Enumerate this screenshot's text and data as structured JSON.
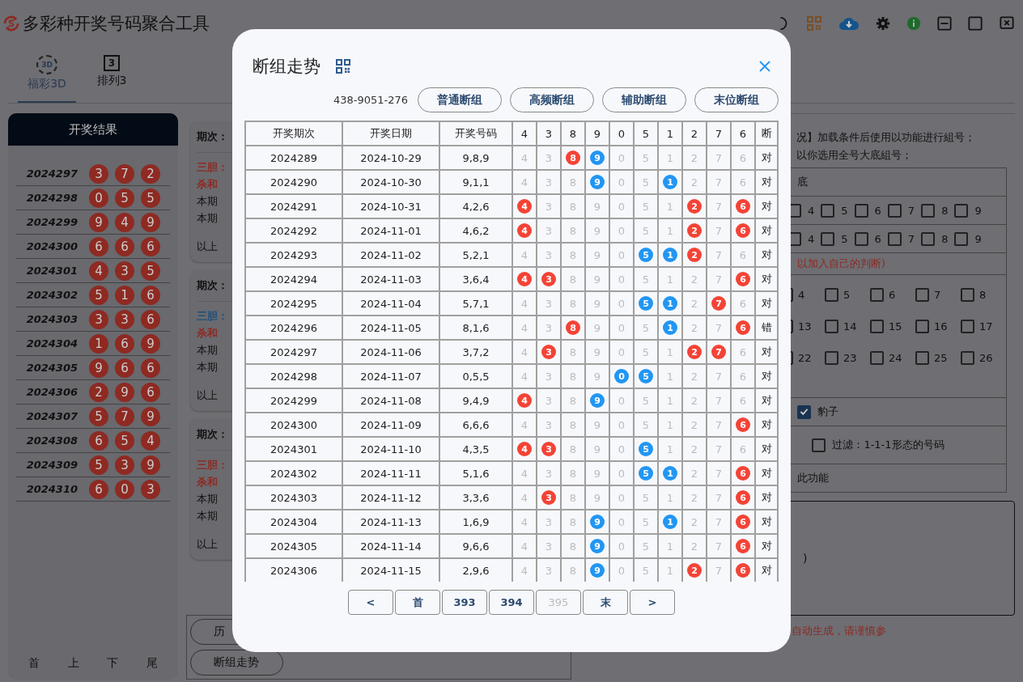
{
  "app": {
    "title": "多彩种开奖号码聚合工具"
  },
  "tabs": [
    {
      "label": "福彩3D",
      "icon_text": "3D",
      "kind": "cycle",
      "selected": true
    },
    {
      "label": "排列3",
      "icon_text": "3",
      "kind": "boxed",
      "selected": false
    }
  ],
  "results": {
    "title": "开奖结果",
    "rows": [
      {
        "period": "2024297",
        "balls": [
          "3",
          "7",
          "2"
        ]
      },
      {
        "period": "2024298",
        "balls": [
          "0",
          "5",
          "5"
        ]
      },
      {
        "period": "2024299",
        "balls": [
          "9",
          "4",
          "9"
        ]
      },
      {
        "period": "2024300",
        "balls": [
          "6",
          "6",
          "6"
        ]
      },
      {
        "period": "2024301",
        "balls": [
          "4",
          "3",
          "5"
        ]
      },
      {
        "period": "2024302",
        "balls": [
          "5",
          "1",
          "6"
        ]
      },
      {
        "period": "2024303",
        "balls": [
          "3",
          "3",
          "6"
        ]
      },
      {
        "period": "2024304",
        "balls": [
          "1",
          "6",
          "9"
        ]
      },
      {
        "period": "2024305",
        "balls": [
          "9",
          "6",
          "6"
        ]
      },
      {
        "period": "2024306",
        "balls": [
          "2",
          "9",
          "6"
        ]
      },
      {
        "period": "2024307",
        "balls": [
          "5",
          "7",
          "9"
        ]
      },
      {
        "period": "2024308",
        "balls": [
          "6",
          "5",
          "4"
        ]
      },
      {
        "period": "2024309",
        "balls": [
          "5",
          "3",
          "9"
        ]
      },
      {
        "period": "2024310",
        "balls": [
          "6",
          "0",
          "3"
        ]
      }
    ],
    "pager": [
      "首",
      "上",
      "下",
      "尾"
    ]
  },
  "cards": [
    {
      "period": "期次：",
      "dan": "三胆：",
      "color": "#8e2a22",
      "lines": [
        "杀和",
        "本期",
        "本期"
      ],
      "footer": "以上"
    },
    {
      "period": "期次：",
      "dan": "三胆：",
      "color": "#1f4f7a",
      "lines": [
        "杀和",
        "本期",
        "本期"
      ],
      "footer": "以上"
    },
    {
      "period": "期次：",
      "dan": "三胆：",
      "color": "#8e2a22",
      "lines": [
        "杀和",
        "本期",
        "本期"
      ],
      "footer": "以上"
    }
  ],
  "bottom_buttons": [
    "历",
    "断组走势"
  ],
  "panel": {
    "notes": [
      "况】加载条件后使用以功能进行組号；",
      "以你选用全号大底組号；"
    ],
    "rows": [
      {
        "kind": "label",
        "text": "底"
      },
      {
        "kind": "checks",
        "items": [
          {
            "label": "4",
            "checked": false
          },
          {
            "label": "5",
            "checked": false
          },
          {
            "label": "6",
            "checked": false
          },
          {
            "label": "7",
            "checked": false
          },
          {
            "label": "8",
            "checked": false
          },
          {
            "label": "9",
            "checked": false
          }
        ]
      },
      {
        "kind": "checks",
        "items": [
          {
            "label": "4",
            "checked": false
          },
          {
            "label": "5",
            "checked": false
          },
          {
            "label": "6",
            "checked": false
          },
          {
            "label": "7",
            "checked": false
          },
          {
            "label": "8",
            "checked": false
          },
          {
            "label": "9",
            "checked": false
          }
        ]
      },
      {
        "kind": "note",
        "text": "以加入自己的判断)"
      },
      {
        "kind": "grid",
        "lines": [
          [
            {
              "label": "4",
              "checked": false
            },
            {
              "label": "5",
              "checked": false
            },
            {
              "label": "6",
              "checked": false
            },
            {
              "label": "7",
              "checked": false
            },
            {
              "label": "8",
              "checked": false
            }
          ],
          [
            {
              "label": "13",
              "checked": false
            },
            {
              "label": "14",
              "checked": false
            },
            {
              "label": "15",
              "checked": false
            },
            {
              "label": "16",
              "checked": false
            },
            {
              "label": "17",
              "checked": false
            }
          ],
          [
            {
              "label": "22",
              "checked": false
            },
            {
              "label": "23",
              "checked": false
            },
            {
              "label": "24",
              "checked": false
            },
            {
              "label": "25",
              "checked": false
            },
            {
              "label": "26",
              "checked": false
            }
          ]
        ]
      },
      {
        "kind": "check",
        "label": "豹子",
        "checked": true
      },
      {
        "kind": "filter",
        "label": "过滤：1-1-1形态的号码",
        "checked": false
      },
      {
        "kind": "label",
        "text": "此功能"
      }
    ],
    "output": ")",
    "warning": "自动生成，请谨慎参"
  },
  "modal": {
    "title": "断组走势",
    "code": "438-9051-276",
    "modes": [
      "普通断组",
      "高频断组",
      "辅助断组",
      "末位断组"
    ],
    "columns": [
      {
        "label": "开奖期次",
        "kind": "text"
      },
      {
        "label": "开奖日期",
        "kind": "text"
      },
      {
        "label": "开奖号码",
        "kind": "text"
      },
      {
        "label": "4",
        "kind": "digit",
        "color": "#f44336"
      },
      {
        "label": "3",
        "kind": "digit",
        "color": "#f44336"
      },
      {
        "label": "8",
        "kind": "digit",
        "color": "#f44336"
      },
      {
        "label": "9",
        "kind": "digit",
        "color": "#2196f3"
      },
      {
        "label": "0",
        "kind": "digit",
        "color": "#2196f3"
      },
      {
        "label": "5",
        "kind": "digit",
        "color": "#2196f3"
      },
      {
        "label": "1",
        "kind": "digit",
        "color": "#2196f3"
      },
      {
        "label": "2",
        "kind": "digit",
        "color": "#f44336"
      },
      {
        "label": "7",
        "kind": "digit",
        "color": "#f44336"
      },
      {
        "label": "6",
        "kind": "digit",
        "color": "#f44336"
      },
      {
        "label": "断",
        "kind": "text"
      }
    ],
    "rows": [
      {
        "cells": [
          "2024289",
          "2024-10-29",
          "9,8,9",
          {
            "text": "4",
            "hit": false
          },
          {
            "text": "3",
            "hit": false
          },
          {
            "text": "8",
            "hit": true
          },
          {
            "text": "9",
            "hit": true
          },
          {
            "text": "0",
            "hit": false
          },
          {
            "text": "5",
            "hit": false
          },
          {
            "text": "1",
            "hit": false
          },
          {
            "text": "2",
            "hit": false
          },
          {
            "text": "7",
            "hit": false
          },
          {
            "text": "6",
            "hit": false
          }
        ],
        "result": "对"
      },
      {
        "cells": [
          "2024290",
          "2024-10-30",
          "9,1,1",
          {
            "text": "4",
            "hit": false
          },
          {
            "text": "3",
            "hit": false
          },
          {
            "text": "8",
            "hit": false
          },
          {
            "text": "9",
            "hit": true
          },
          {
            "text": "0",
            "hit": false
          },
          {
            "text": "5",
            "hit": false
          },
          {
            "text": "1",
            "hit": true
          },
          {
            "text": "2",
            "hit": false
          },
          {
            "text": "7",
            "hit": false
          },
          {
            "text": "6",
            "hit": false
          }
        ],
        "result": "对"
      },
      {
        "cells": [
          "2024291",
          "2024-10-31",
          "4,2,6",
          {
            "text": "4",
            "hit": true
          },
          {
            "text": "3",
            "hit": false
          },
          {
            "text": "8",
            "hit": false
          },
          {
            "text": "9",
            "hit": false
          },
          {
            "text": "0",
            "hit": false
          },
          {
            "text": "5",
            "hit": false
          },
          {
            "text": "1",
            "hit": false
          },
          {
            "text": "2",
            "hit": true
          },
          {
            "text": "7",
            "hit": false
          },
          {
            "text": "6",
            "hit": true
          }
        ],
        "result": "对"
      },
      {
        "cells": [
          "2024292",
          "2024-11-01",
          "4,6,2",
          {
            "text": "4",
            "hit": true
          },
          {
            "text": "3",
            "hit": false
          },
          {
            "text": "8",
            "hit": false
          },
          {
            "text": "9",
            "hit": false
          },
          {
            "text": "0",
            "hit": false
          },
          {
            "text": "5",
            "hit": false
          },
          {
            "text": "1",
            "hit": false
          },
          {
            "text": "2",
            "hit": true
          },
          {
            "text": "7",
            "hit": false
          },
          {
            "text": "6",
            "hit": true
          }
        ],
        "result": "对"
      },
      {
        "cells": [
          "2024293",
          "2024-11-02",
          "5,2,1",
          {
            "text": "4",
            "hit": false
          },
          {
            "text": "3",
            "hit": false
          },
          {
            "text": "8",
            "hit": false
          },
          {
            "text": "9",
            "hit": false
          },
          {
            "text": "0",
            "hit": false
          },
          {
            "text": "5",
            "hit": true
          },
          {
            "text": "1",
            "hit": true
          },
          {
            "text": "2",
            "hit": true
          },
          {
            "text": "7",
            "hit": false
          },
          {
            "text": "6",
            "hit": false
          }
        ],
        "result": "对"
      },
      {
        "cells": [
          "2024294",
          "2024-11-03",
          "3,6,4",
          {
            "text": "4",
            "hit": true
          },
          {
            "text": "3",
            "hit": true
          },
          {
            "text": "8",
            "hit": false
          },
          {
            "text": "9",
            "hit": false
          },
          {
            "text": "0",
            "hit": false
          },
          {
            "text": "5",
            "hit": false
          },
          {
            "text": "1",
            "hit": false
          },
          {
            "text": "2",
            "hit": false
          },
          {
            "text": "7",
            "hit": false
          },
          {
            "text": "6",
            "hit": true
          }
        ],
        "result": "对"
      },
      {
        "cells": [
          "2024295",
          "2024-11-04",
          "5,7,1",
          {
            "text": "4",
            "hit": false
          },
          {
            "text": "3",
            "hit": false
          },
          {
            "text": "8",
            "hit": false
          },
          {
            "text": "9",
            "hit": false
          },
          {
            "text": "0",
            "hit": false
          },
          {
            "text": "5",
            "hit": true
          },
          {
            "text": "1",
            "hit": true
          },
          {
            "text": "2",
            "hit": false
          },
          {
            "text": "7",
            "hit": true
          },
          {
            "text": "6",
            "hit": false
          }
        ],
        "result": "对"
      },
      {
        "cells": [
          "2024296",
          "2024-11-05",
          "8,1,6",
          {
            "text": "4",
            "hit": false
          },
          {
            "text": "3",
            "hit": false
          },
          {
            "text": "8",
            "hit": true
          },
          {
            "text": "9",
            "hit": false
          },
          {
            "text": "0",
            "hit": false
          },
          {
            "text": "5",
            "hit": false
          },
          {
            "text": "1",
            "hit": true
          },
          {
            "text": "2",
            "hit": false
          },
          {
            "text": "7",
            "hit": false
          },
          {
            "text": "6",
            "hit": true
          }
        ],
        "result": "错"
      },
      {
        "cells": [
          "2024297",
          "2024-11-06",
          "3,7,2",
          {
            "text": "4",
            "hit": false
          },
          {
            "text": "3",
            "hit": true
          },
          {
            "text": "8",
            "hit": false
          },
          {
            "text": "9",
            "hit": false
          },
          {
            "text": "0",
            "hit": false
          },
          {
            "text": "5",
            "hit": false
          },
          {
            "text": "1",
            "hit": false
          },
          {
            "text": "2",
            "hit": true
          },
          {
            "text": "7",
            "hit": true
          },
          {
            "text": "6",
            "hit": false
          }
        ],
        "result": "对"
      },
      {
        "cells": [
          "2024298",
          "2024-11-07",
          "0,5,5",
          {
            "text": "4",
            "hit": false
          },
          {
            "text": "3",
            "hit": false
          },
          {
            "text": "8",
            "hit": false
          },
          {
            "text": "9",
            "hit": false
          },
          {
            "text": "0",
            "hit": true
          },
          {
            "text": "5",
            "hit": true
          },
          {
            "text": "1",
            "hit": false
          },
          {
            "text": "2",
            "hit": false
          },
          {
            "text": "7",
            "hit": false
          },
          {
            "text": "6",
            "hit": false
          }
        ],
        "result": "对"
      },
      {
        "cells": [
          "2024299",
          "2024-11-08",
          "9,4,9",
          {
            "text": "4",
            "hit": true
          },
          {
            "text": "3",
            "hit": false
          },
          {
            "text": "8",
            "hit": false
          },
          {
            "text": "9",
            "hit": true
          },
          {
            "text": "0",
            "hit": false
          },
          {
            "text": "5",
            "hit": false
          },
          {
            "text": "1",
            "hit": false
          },
          {
            "text": "2",
            "hit": false
          },
          {
            "text": "7",
            "hit": false
          },
          {
            "text": "6",
            "hit": false
          }
        ],
        "result": "对"
      },
      {
        "cells": [
          "2024300",
          "2024-11-09",
          "6,6,6",
          {
            "text": "4",
            "hit": false
          },
          {
            "text": "3",
            "hit": false
          },
          {
            "text": "8",
            "hit": false
          },
          {
            "text": "9",
            "hit": false
          },
          {
            "text": "0",
            "hit": false
          },
          {
            "text": "5",
            "hit": false
          },
          {
            "text": "1",
            "hit": false
          },
          {
            "text": "2",
            "hit": false
          },
          {
            "text": "7",
            "hit": false
          },
          {
            "text": "6",
            "hit": true
          }
        ],
        "result": "对"
      },
      {
        "cells": [
          "2024301",
          "2024-11-10",
          "4,3,5",
          {
            "text": "4",
            "hit": true
          },
          {
            "text": "3",
            "hit": true
          },
          {
            "text": "8",
            "hit": false
          },
          {
            "text": "9",
            "hit": false
          },
          {
            "text": "0",
            "hit": false
          },
          {
            "text": "5",
            "hit": true
          },
          {
            "text": "1",
            "hit": false
          },
          {
            "text": "2",
            "hit": false
          },
          {
            "text": "7",
            "hit": false
          },
          {
            "text": "6",
            "hit": false
          }
        ],
        "result": "对"
      },
      {
        "cells": [
          "2024302",
          "2024-11-11",
          "5,1,6",
          {
            "text": "4",
            "hit": false
          },
          {
            "text": "3",
            "hit": false
          },
          {
            "text": "8",
            "hit": false
          },
          {
            "text": "9",
            "hit": false
          },
          {
            "text": "0",
            "hit": false
          },
          {
            "text": "5",
            "hit": true
          },
          {
            "text": "1",
            "hit": true
          },
          {
            "text": "2",
            "hit": false
          },
          {
            "text": "7",
            "hit": false
          },
          {
            "text": "6",
            "hit": true
          }
        ],
        "result": "对"
      },
      {
        "cells": [
          "2024303",
          "2024-11-12",
          "3,3,6",
          {
            "text": "4",
            "hit": false
          },
          {
            "text": "3",
            "hit": true
          },
          {
            "text": "8",
            "hit": false
          },
          {
            "text": "9",
            "hit": false
          },
          {
            "text": "0",
            "hit": false
          },
          {
            "text": "5",
            "hit": false
          },
          {
            "text": "1",
            "hit": false
          },
          {
            "text": "2",
            "hit": false
          },
          {
            "text": "7",
            "hit": false
          },
          {
            "text": "6",
            "hit": true
          }
        ],
        "result": "对"
      },
      {
        "cells": [
          "2024304",
          "2024-11-13",
          "1,6,9",
          {
            "text": "4",
            "hit": false
          },
          {
            "text": "3",
            "hit": false
          },
          {
            "text": "8",
            "hit": false
          },
          {
            "text": "9",
            "hit": true
          },
          {
            "text": "0",
            "hit": false
          },
          {
            "text": "5",
            "hit": false
          },
          {
            "text": "1",
            "hit": true
          },
          {
            "text": "2",
            "hit": false
          },
          {
            "text": "7",
            "hit": false
          },
          {
            "text": "6",
            "hit": true
          }
        ],
        "result": "对"
      },
      {
        "cells": [
          "2024305",
          "2024-11-14",
          "9,6,6",
          {
            "text": "4",
            "hit": false
          },
          {
            "text": "3",
            "hit": false
          },
          {
            "text": "8",
            "hit": false
          },
          {
            "text": "9",
            "hit": true
          },
          {
            "text": "0",
            "hit": false
          },
          {
            "text": "5",
            "hit": false
          },
          {
            "text": "1",
            "hit": false
          },
          {
            "text": "2",
            "hit": false
          },
          {
            "text": "7",
            "hit": false
          },
          {
            "text": "6",
            "hit": true
          }
        ],
        "result": "对"
      },
      {
        "cells": [
          "2024306",
          "2024-11-15",
          "2,9,6",
          {
            "text": "4",
            "hit": false
          },
          {
            "text": "3",
            "hit": false
          },
          {
            "text": "8",
            "hit": false
          },
          {
            "text": "9",
            "hit": true
          },
          {
            "text": "0",
            "hit": false
          },
          {
            "text": "5",
            "hit": false
          },
          {
            "text": "1",
            "hit": false
          },
          {
            "text": "2",
            "hit": true
          },
          {
            "text": "7",
            "hit": false
          },
          {
            "text": "6",
            "hit": true
          }
        ],
        "result": "对"
      }
    ],
    "pages": [
      {
        "label": "<",
        "disabled": false
      },
      {
        "label": "首",
        "disabled": false
      },
      {
        "label": "393",
        "disabled": false
      },
      {
        "label": "394",
        "disabled": false
      },
      {
        "label": "395",
        "disabled": true
      },
      {
        "label": "末",
        "disabled": false
      },
      {
        "label": ">",
        "disabled": false
      }
    ]
  }
}
